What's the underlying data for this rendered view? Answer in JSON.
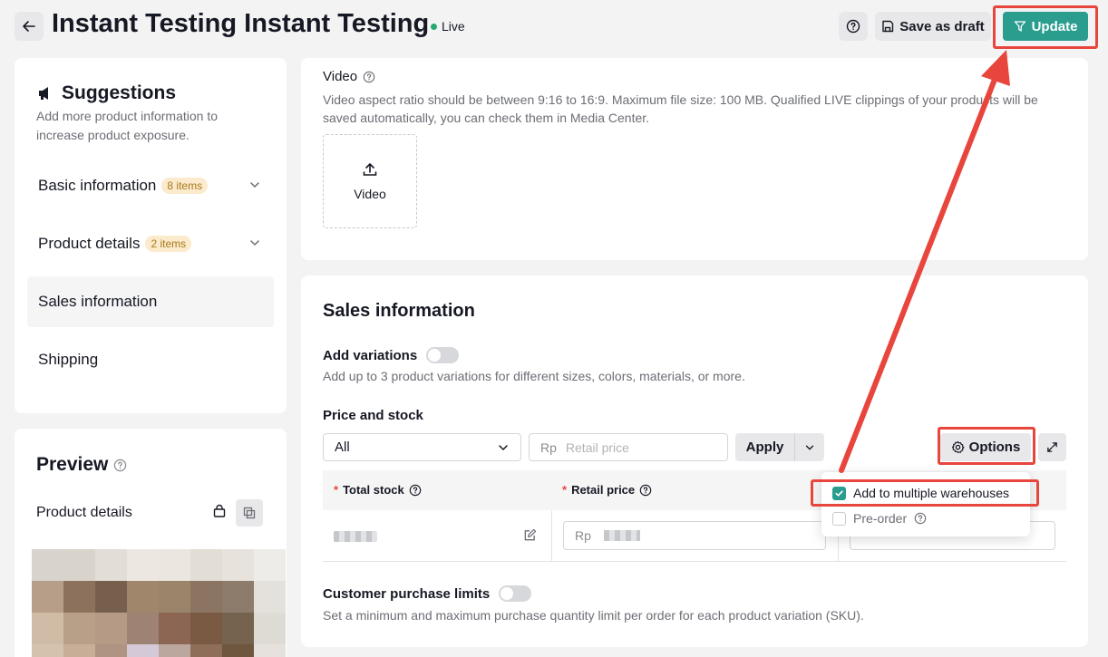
{
  "header": {
    "title": "Instant Testing Instant Testing",
    "status": "Live",
    "save_draft_label": "Save as draft",
    "update_label": "Update"
  },
  "suggestions": {
    "title": "Suggestions",
    "description": "Add more product information to increase product exposure.",
    "items": [
      {
        "label": "Basic information",
        "badge": "8 items"
      },
      {
        "label": "Product details",
        "badge": "2 items"
      },
      {
        "label": "Sales information",
        "badge": ""
      },
      {
        "label": "Shipping",
        "badge": ""
      }
    ]
  },
  "preview": {
    "title": "Preview",
    "subtitle": "Product details"
  },
  "video": {
    "label": "Video",
    "description": "Video aspect ratio should be between 9:16 to 16:9. Maximum file size: 100 MB. Qualified LIVE clippings of your products will be saved automatically, you can check them in Media Center.",
    "upload_label": "Video"
  },
  "sales": {
    "title": "Sales information",
    "add_variations_label": "Add variations",
    "add_variations_desc": "Add up to 3 product variations for different sizes, colors, materials, or more.",
    "price_stock_label": "Price and stock",
    "select_value": "All",
    "retail_prefix": "Rp",
    "retail_placeholder": "Retail price",
    "apply_label": "Apply",
    "options_label": "Options",
    "columns": [
      "Total stock",
      "Retail price"
    ],
    "row_price_prefix": "Rp",
    "dropdown_options": [
      {
        "label": "Add to multiple warehouses",
        "checked": true
      },
      {
        "label": "Pre-order",
        "checked": false
      }
    ],
    "cpl_label": "Customer purchase limits",
    "cpl_desc": "Set a minimum and maximum purchase quantity limit per order for each product variation (SKU)."
  },
  "colors": {
    "accent": "#2a9d8f",
    "highlight": "#e8453c",
    "live": "#23a971"
  },
  "mosaic_colors": [
    "#d9d3cd",
    "#d8d3cb",
    "#e2ddd6",
    "#ece8e1",
    "#ebe6df",
    "#e2ddd5",
    "#e7e2dc",
    "#eeece9",
    "#b79e88",
    "#8c725c",
    "#76604d",
    "#a0876c",
    "#9a846a",
    "#8b7562",
    "#8d7b6c",
    "#e4e0dc",
    "#d0bca6",
    "#b7a087",
    "#b59a86",
    "#9e8273",
    "#8c6652",
    "#7b5a44",
    "#75624f",
    "#dedad4",
    "#d4c2ae",
    "#c8ae97",
    "#b09483",
    "#d4cad7",
    "#bba79e",
    "#8f6e59",
    "#6f573f",
    "#e6e1dc"
  ]
}
